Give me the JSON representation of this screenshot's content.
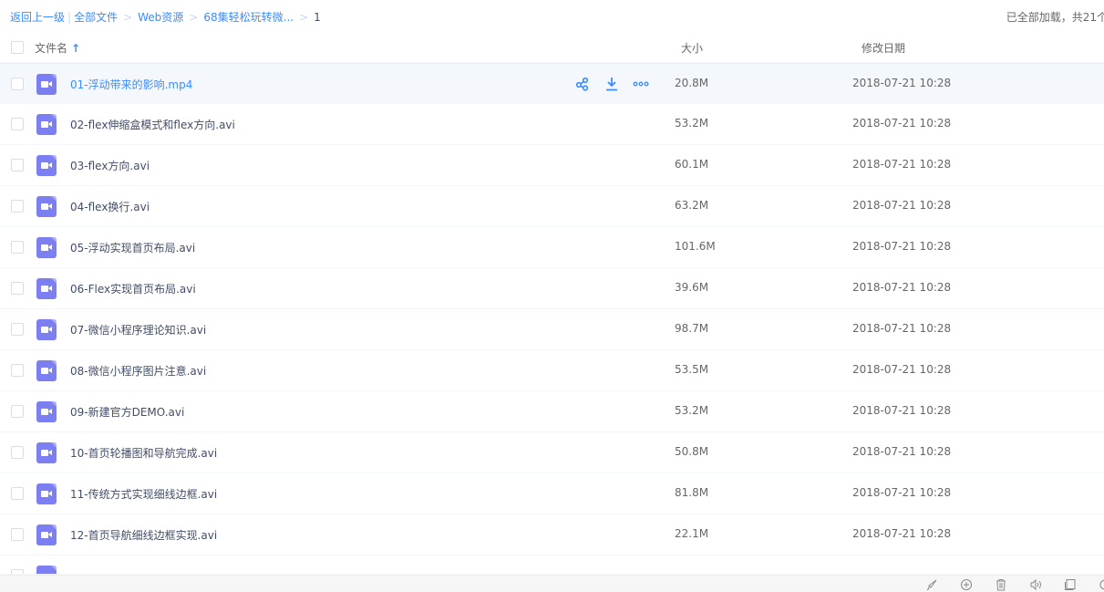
{
  "breadcrumb": {
    "back": "返回上一级",
    "divider": "|",
    "items": [
      "全部文件",
      "Web资源",
      "68集轻松玩转微..."
    ],
    "separator": ">",
    "current": "1"
  },
  "load_status": "已全部加载，共21个",
  "columns": {
    "name": "文件名",
    "sort_icon": "arrow-up",
    "size": "大小",
    "date": "修改日期"
  },
  "accent_color": "#3b8cff",
  "file_icon_color": "#7b7ff2",
  "row_actions": [
    "share-icon",
    "download-icon",
    "more-icon"
  ],
  "files": [
    {
      "name": "01-浮动带来的影响.mp4",
      "size": "20.8M",
      "date": "2018-07-21 10:28",
      "hovered": true
    },
    {
      "name": "02-flex伸缩盒模式和flex方向.avi",
      "size": "53.2M",
      "date": "2018-07-21 10:28"
    },
    {
      "name": "03-flex方向.avi",
      "size": "60.1M",
      "date": "2018-07-21 10:28"
    },
    {
      "name": "04-flex换行.avi",
      "size": "63.2M",
      "date": "2018-07-21 10:28"
    },
    {
      "name": "05-浮动实现首页布局.avi",
      "size": "101.6M",
      "date": "2018-07-21 10:28"
    },
    {
      "name": "06-Flex实现首页布局.avi",
      "size": "39.6M",
      "date": "2018-07-21 10:28"
    },
    {
      "name": "07-微信小程序理论知识.avi",
      "size": "98.7M",
      "date": "2018-07-21 10:28"
    },
    {
      "name": "08-微信小程序图片注意.avi",
      "size": "53.5M",
      "date": "2018-07-21 10:28"
    },
    {
      "name": "09-新建官方DEMO.avi",
      "size": "53.2M",
      "date": "2018-07-21 10:28"
    },
    {
      "name": "10-首页轮播图和导航完成.avi",
      "size": "50.8M",
      "date": "2018-07-21 10:28"
    },
    {
      "name": "11-传统方式实现细线边框.avi",
      "size": "81.8M",
      "date": "2018-07-21 10:28"
    },
    {
      "name": "12-首页导航细线边框实现.avi",
      "size": "22.1M",
      "date": "2018-07-21 10:28"
    }
  ],
  "bottom_toolbar": [
    "rocket-icon",
    "refresh-icon",
    "trash-icon",
    "speaker-icon",
    "window-icon",
    "search-icon"
  ]
}
